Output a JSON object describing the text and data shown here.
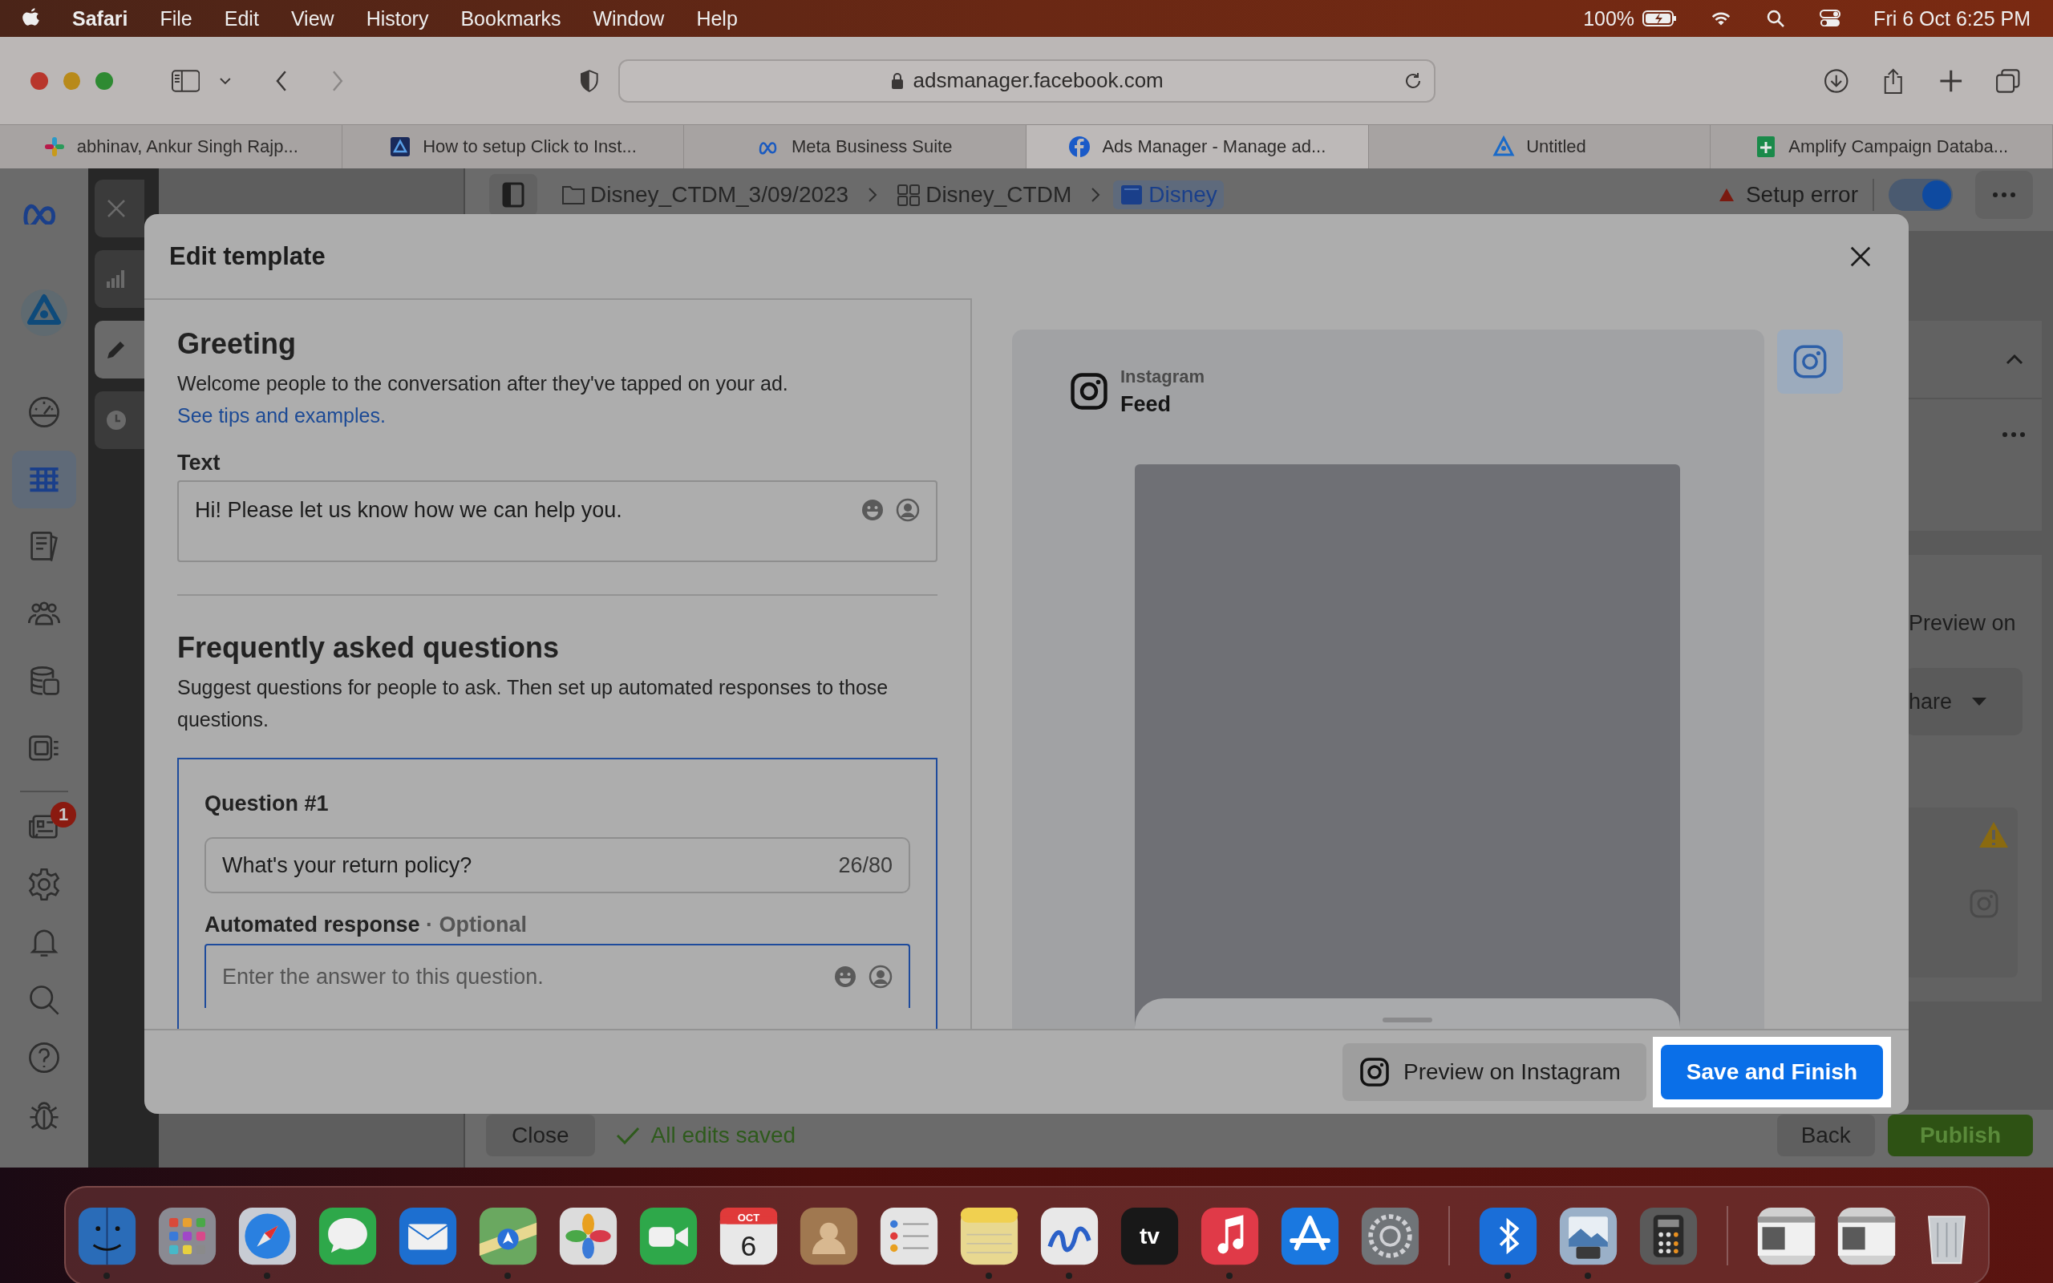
{
  "menu_bar": {
    "app": "Safari",
    "items": [
      "File",
      "Edit",
      "View",
      "History",
      "Bookmarks",
      "Window",
      "Help"
    ],
    "battery": "100%",
    "clock": "Fri 6 Oct 6:25 PM"
  },
  "browser": {
    "url": "adsmanager.facebook.com",
    "tabs": [
      {
        "kind": "pinwheel",
        "title": "abhinav, Ankur Singh Rajp...",
        "selected": false
      },
      {
        "kind": "doc",
        "title": "How to setup Click to Inst...",
        "selected": false
      },
      {
        "kind": "meta",
        "title": "Meta Business Suite",
        "selected": false
      },
      {
        "kind": "facebook",
        "title": "Ads Manager - Manage ad...",
        "selected": true
      },
      {
        "kind": "triangle",
        "title": "Untitled",
        "selected": false
      },
      {
        "kind": "sheet",
        "title": "Amplify Campaign Databa...",
        "selected": false
      }
    ]
  },
  "page": {
    "nav_top": [
      {
        "kind": "gauge",
        "selected": false
      },
      {
        "kind": "table",
        "selected": true
      },
      {
        "kind": "pages",
        "selected": false
      },
      {
        "kind": "people",
        "selected": false
      },
      {
        "kind": "stack",
        "selected": false
      },
      {
        "kind": "gallery",
        "selected": false
      }
    ],
    "nav_bottom": [
      {
        "kind": "news",
        "selected": false,
        "badge": "1"
      },
      {
        "kind": "gear",
        "selected": false
      },
      {
        "kind": "bell",
        "selected": false
      },
      {
        "kind": "search",
        "selected": false
      },
      {
        "kind": "help",
        "selected": false
      },
      {
        "kind": "bug",
        "selected": false
      }
    ],
    "tools": [
      {
        "kind": "close",
        "selected": false
      },
      {
        "kind": "chart",
        "selected": false
      },
      {
        "kind": "pencil",
        "selected": true
      },
      {
        "kind": "clock",
        "selected": false
      }
    ],
    "breadcrumbs": [
      {
        "kind": "folder",
        "label": "Disney_CTDM_3/09/2023",
        "selected": false
      },
      {
        "kind": "grid",
        "label": "Disney_CTDM",
        "selected": false
      },
      {
        "kind": "ad",
        "label": "Disney",
        "selected": true
      }
    ],
    "status": "Setup error",
    "toggle": {
      "on": true
    },
    "right_panel": {
      "preview_label": "Preview on",
      "dropdown": "hare"
    },
    "footer": {
      "close": "Close",
      "saved": "All edits saved",
      "back": "Back",
      "publish": "Publish"
    }
  },
  "modal": {
    "title": "Edit template",
    "greeting": {
      "heading": "Greeting",
      "description": "Welcome people to the conversation after they've tapped on your ad.",
      "link": "See tips and examples.",
      "text_label": "Text",
      "text_value": "Hi! Please let us know how we can help you."
    },
    "faq": {
      "heading": "Frequently asked questions",
      "description": "Suggest questions for people to ask. Then set up automated responses to those questions.",
      "questions": [
        {
          "label": "Question #1",
          "value": "What's your return policy?",
          "count": "26/80",
          "response_label": "Automated response",
          "optional": "· Optional",
          "response_placeholder": "Enter the answer to this question."
        }
      ]
    },
    "preview": {
      "platform": "Instagram",
      "placement": "Feed"
    },
    "buttons": {
      "preview": "Preview on Instagram",
      "save": "Save and Finish",
      "save_highlighted": true
    }
  },
  "dock": {
    "sections": [
      {
        "apps": [
          {
            "kind": "finder",
            "running": true
          },
          {
            "kind": "launchpad",
            "running": false
          },
          {
            "kind": "safari",
            "running": true
          },
          {
            "kind": "messages",
            "running": false
          },
          {
            "kind": "mail",
            "running": false
          },
          {
            "kind": "maps",
            "running": true
          },
          {
            "kind": "photos",
            "running": false
          },
          {
            "kind": "facetime",
            "running": false
          },
          {
            "kind": "calendar",
            "running": false,
            "month": "OCT",
            "day": "6"
          },
          {
            "kind": "contacts",
            "running": false
          },
          {
            "kind": "reminders",
            "running": false
          },
          {
            "kind": "notes",
            "running": true
          },
          {
            "kind": "freeform",
            "running": true
          },
          {
            "kind": "tv",
            "running": false,
            "label": "tv"
          },
          {
            "kind": "music",
            "running": true
          },
          {
            "kind": "appstore",
            "running": false
          },
          {
            "kind": "settings",
            "running": false
          }
        ]
      },
      {
        "apps": [
          {
            "kind": "bluetooth",
            "running": true
          },
          {
            "kind": "preview",
            "running": true
          },
          {
            "kind": "calculator",
            "running": false
          }
        ]
      },
      {
        "apps": [
          {
            "kind": "window",
            "running": false
          },
          {
            "kind": "window",
            "running": false
          },
          {
            "kind": "trash",
            "running": false
          }
        ]
      }
    ]
  }
}
